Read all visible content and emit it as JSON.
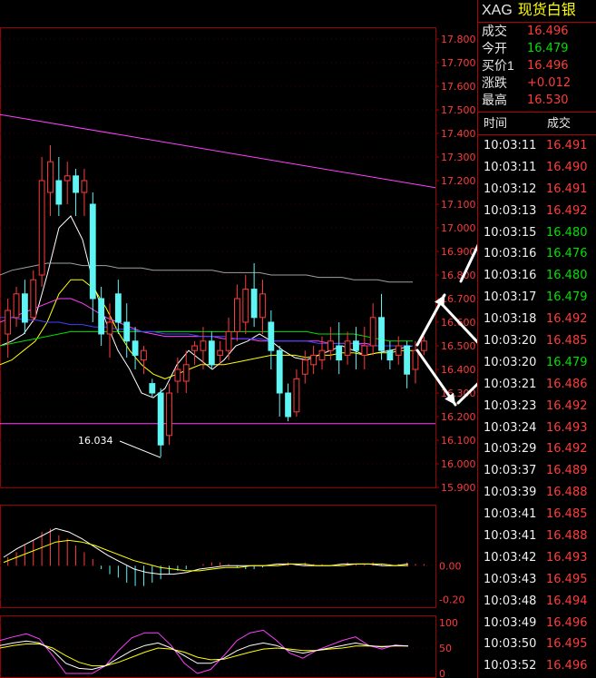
{
  "chart_data": {
    "type": "candlestick",
    "y_ticks": [
      "17.800",
      "17.700",
      "17.600",
      "17.500",
      "17.400",
      "17.300",
      "17.200",
      "17.100",
      "17.000",
      "16.900",
      "16.800",
      "16.700",
      "16.600",
      "16.500",
      "16.400",
      "16.300",
      "16.200",
      "16.100",
      "16.000",
      "15.900"
    ],
    "ylim": [
      15.9,
      17.85
    ],
    "low_marker": {
      "label": "16.034",
      "value": 16.034
    },
    "candles": [
      [
        16.55,
        16.65,
        16.45,
        16.7
      ],
      [
        16.62,
        16.72,
        16.58,
        16.75
      ],
      [
        16.72,
        16.6,
        16.55,
        16.78
      ],
      [
        16.62,
        16.78,
        16.6,
        16.82
      ],
      [
        16.8,
        17.2,
        16.75,
        17.3
      ],
      [
        17.15,
        17.28,
        17.05,
        17.35
      ],
      [
        17.2,
        17.1,
        17.05,
        17.3
      ],
      [
        17.2,
        17.22,
        17.1,
        17.28
      ],
      [
        17.22,
        17.15,
        17.05,
        17.25
      ],
      [
        17.15,
        17.2,
        17.05,
        17.25
      ],
      [
        17.1,
        16.7,
        16.6,
        17.15
      ],
      [
        16.7,
        16.55,
        16.5,
        16.75
      ],
      [
        16.55,
        16.6,
        16.45,
        16.68
      ],
      [
        16.72,
        16.6,
        16.55,
        16.78
      ],
      [
        16.6,
        16.52,
        16.45,
        16.68
      ],
      [
        16.52,
        16.46,
        16.4,
        16.58
      ],
      [
        16.44,
        16.48,
        16.38,
        16.5
      ],
      [
        16.34,
        16.3,
        16.28,
        16.36
      ],
      [
        16.3,
        16.08,
        16.03,
        16.32
      ],
      [
        16.12,
        16.3,
        16.08,
        16.34
      ],
      [
        16.35,
        16.4,
        16.3,
        16.45
      ],
      [
        16.35,
        16.42,
        16.3,
        16.48
      ],
      [
        16.48,
        16.5,
        16.42,
        16.52
      ],
      [
        16.48,
        16.52,
        16.4,
        16.58
      ],
      [
        16.52,
        16.42,
        16.4,
        16.56
      ],
      [
        16.46,
        16.48,
        16.42,
        16.52
      ],
      [
        16.48,
        16.56,
        16.44,
        16.62
      ],
      [
        16.56,
        16.7,
        16.52,
        16.76
      ],
      [
        16.6,
        16.74,
        16.55,
        16.8
      ],
      [
        16.74,
        16.62,
        16.58,
        16.85
      ],
      [
        16.62,
        16.72,
        16.55,
        16.78
      ],
      [
        16.6,
        16.48,
        16.4,
        16.65
      ],
      [
        16.48,
        16.3,
        16.2,
        16.5
      ],
      [
        16.3,
        16.2,
        16.18,
        16.34
      ],
      [
        16.22,
        16.36,
        16.2,
        16.4
      ],
      [
        16.38,
        16.44,
        16.34,
        16.48
      ],
      [
        16.42,
        16.46,
        16.38,
        16.5
      ],
      [
        16.44,
        16.48,
        16.4,
        16.54
      ],
      [
        16.48,
        16.52,
        16.44,
        16.58
      ],
      [
        16.5,
        16.44,
        16.38,
        16.6
      ],
      [
        16.46,
        16.52,
        16.42,
        16.56
      ],
      [
        16.52,
        16.48,
        16.4,
        16.58
      ],
      [
        16.46,
        16.5,
        16.4,
        16.58
      ],
      [
        16.5,
        16.62,
        16.46,
        16.68
      ],
      [
        16.62,
        16.48,
        16.44,
        16.72
      ],
      [
        16.48,
        16.44,
        16.4,
        16.52
      ],
      [
        16.46,
        16.5,
        16.42,
        16.54
      ],
      [
        16.5,
        16.38,
        16.32,
        16.52
      ],
      [
        16.4,
        16.48,
        16.34,
        16.52
      ],
      [
        16.48,
        16.52,
        16.46,
        16.54
      ]
    ],
    "lines": [
      {
        "color": "#ffffff",
        "values": [
          16.5,
          16.52,
          16.55,
          16.62,
          16.8,
          17.0,
          17.05,
          16.95,
          16.75,
          16.6,
          16.48,
          16.4,
          16.3,
          16.28,
          16.32,
          16.42,
          16.48,
          16.44,
          16.4,
          16.44,
          16.5,
          16.52,
          16.55,
          16.52,
          16.48,
          16.45,
          16.44,
          16.46,
          16.48,
          16.5,
          16.48,
          16.46,
          16.47,
          16.48,
          16.49,
          16.5
        ]
      },
      {
        "color": "#ffff00",
        "values": [
          16.42,
          16.44,
          16.48,
          16.52,
          16.6,
          16.72,
          16.78,
          16.78,
          16.74,
          16.66,
          16.56,
          16.48,
          16.42,
          16.38,
          16.36,
          16.38,
          16.4,
          16.42,
          16.42,
          16.42,
          16.43,
          16.44,
          16.45,
          16.46,
          16.46,
          16.46,
          16.45,
          16.46,
          16.46,
          16.47,
          16.47,
          16.46,
          16.47,
          16.47,
          16.48,
          16.48
        ]
      },
      {
        "color": "#ff40ff",
        "values": [
          16.6,
          16.62,
          16.64,
          16.66,
          16.68,
          16.7,
          16.7,
          16.68,
          16.65,
          16.62,
          16.6,
          16.58,
          16.56,
          16.55,
          16.54,
          16.54,
          16.54,
          16.54,
          16.54,
          16.53,
          16.53,
          16.53,
          16.52,
          16.52,
          16.52,
          16.52,
          16.52,
          16.52,
          16.51,
          16.51,
          16.51,
          16.51,
          16.5,
          16.5,
          16.5,
          16.5
        ]
      },
      {
        "color": "#00e000",
        "values": [
          16.5,
          16.51,
          16.52,
          16.53,
          16.54,
          16.55,
          16.56,
          16.56,
          16.56,
          16.56,
          16.56,
          16.56,
          16.56,
          16.56,
          16.56,
          16.56,
          16.56,
          16.56,
          16.56,
          16.56,
          16.56,
          16.56,
          16.56,
          16.56,
          16.56,
          16.56,
          16.56,
          16.55,
          16.55,
          16.55,
          16.55,
          16.54,
          16.53,
          16.52,
          16.52,
          16.52
        ]
      },
      {
        "color": "#4040ff",
        "values": [
          16.62,
          16.62,
          16.61,
          16.61,
          16.6,
          16.6,
          16.59,
          16.59,
          16.58,
          16.58,
          16.57,
          16.57,
          16.56,
          16.56,
          16.55,
          16.55,
          16.55,
          16.54,
          16.54,
          16.54,
          16.53,
          16.53,
          16.53,
          16.52,
          16.52,
          16.52,
          16.52,
          16.51,
          16.51,
          16.51,
          16.51,
          16.5,
          16.5,
          16.5,
          16.5,
          16.5
        ]
      },
      {
        "color": "#a0a0a0",
        "values": [
          16.8,
          16.82,
          16.83,
          16.84,
          16.85,
          16.85,
          16.85,
          16.84,
          16.84,
          16.84,
          16.83,
          16.83,
          16.83,
          16.82,
          16.82,
          16.82,
          16.82,
          16.82,
          16.82,
          16.81,
          16.81,
          16.81,
          16.81,
          16.8,
          16.8,
          16.8,
          16.8,
          16.79,
          16.79,
          16.79,
          16.78,
          16.78,
          16.78,
          16.77,
          16.77,
          16.77
        ]
      }
    ],
    "trendline": {
      "color": "#ff40ff",
      "from": [
        -0.5,
        17.48
      ],
      "to": [
        1,
        17.17
      ]
    },
    "support": {
      "color": "#ff40ff",
      "value": 16.17
    },
    "macd": {
      "y_ticks": [
        "0.00",
        "-0.20"
      ],
      "ylim": [
        -0.24,
        0.34
      ],
      "bars": [
        0.05,
        0.08,
        0.12,
        0.15,
        0.2,
        0.22,
        0.18,
        0.16,
        0.12,
        0.08,
        0.04,
        -0.02,
        -0.05,
        -0.07,
        -0.1,
        -0.12,
        -0.12,
        -0.1,
        -0.08,
        -0.05,
        -0.03,
        -0.02,
        0.0,
        0.01,
        0.02,
        0.02,
        0.01,
        -0.01,
        -0.02,
        -0.02,
        -0.01,
        0.0,
        0.01,
        0.02,
        0.01,
        0.02,
        0.01,
        0.01,
        0.0,
        0.01,
        0.02,
        0.01,
        0.01,
        0.02,
        0.01,
        0.01,
        0.01,
        0.02,
        0.01,
        0.01
      ],
      "dif": [
        0.05,
        0.1,
        0.14,
        0.18,
        0.22,
        0.2,
        0.16,
        0.11,
        0.06,
        0.02,
        -0.02,
        -0.04,
        -0.05,
        -0.05,
        -0.04,
        -0.02,
        -0.01,
        0.0,
        0.0,
        0.0,
        0.0,
        0.01,
        0.01,
        0.0,
        0.0,
        0.0,
        0.01,
        0.01,
        0.01,
        0.0,
        0.0,
        0.01
      ],
      "dea": [
        0.02,
        0.05,
        0.08,
        0.11,
        0.14,
        0.15,
        0.14,
        0.12,
        0.09,
        0.06,
        0.03,
        0.01,
        -0.01,
        -0.02,
        -0.03,
        -0.03,
        -0.02,
        -0.01,
        -0.01,
        0.0,
        0.0,
        0.0,
        0.01,
        0.01,
        0.0,
        0.0,
        0.0,
        0.01,
        0.01,
        0.01,
        0.0,
        0.0
      ]
    },
    "kdj": {
      "y_ticks": [
        "100",
        "50",
        "0"
      ],
      "ylim": [
        0,
        100
      ],
      "k": [
        55,
        60,
        64,
        60,
        45,
        20,
        10,
        8,
        15,
        30,
        45,
        55,
        60,
        50,
        35,
        20,
        20,
        30,
        45,
        55,
        60,
        55,
        45,
        40,
        45,
        50,
        55,
        60,
        55,
        52,
        55,
        54
      ],
      "d": [
        50,
        55,
        58,
        58,
        50,
        35,
        22,
        15,
        15,
        22,
        32,
        42,
        50,
        48,
        42,
        32,
        27,
        28,
        35,
        42,
        48,
        50,
        48,
        45,
        45,
        48,
        50,
        54,
        54,
        53,
        54,
        54
      ],
      "j": [
        65,
        72,
        78,
        68,
        35,
        0,
        0,
        0,
        15,
        45,
        70,
        80,
        80,
        55,
        20,
        0,
        8,
        35,
        65,
        80,
        85,
        65,
        40,
        30,
        45,
        55,
        65,
        72,
        55,
        48,
        56,
        54
      ]
    }
  },
  "quote": {
    "code": "XAG",
    "name": "现货白银",
    "rows": [
      {
        "label": "成交",
        "value": "16.496",
        "color": "red"
      },
      {
        "label": "今开",
        "value": "16.479",
        "color": "green"
      },
      {
        "label": "买价1",
        "value": "16.496",
        "color": "red"
      },
      {
        "label": "涨跌",
        "value": "+0.012",
        "color": "red"
      },
      {
        "label": "最高",
        "value": "16.530",
        "color": "red"
      }
    ],
    "col_time": "时间",
    "col_price": "成交",
    "ticks": [
      {
        "t": "10:03:11",
        "p": "16.491",
        "c": "red"
      },
      {
        "t": "10:03:11",
        "p": "16.490",
        "c": "red"
      },
      {
        "t": "10:03:12",
        "p": "16.491",
        "c": "red"
      },
      {
        "t": "10:03:13",
        "p": "16.492",
        "c": "red"
      },
      {
        "t": "10:03:15",
        "p": "16.480",
        "c": "green"
      },
      {
        "t": "10:03:16",
        "p": "16.476",
        "c": "green"
      },
      {
        "t": "10:03:16",
        "p": "16.480",
        "c": "green"
      },
      {
        "t": "10:03:17",
        "p": "16.479",
        "c": "green"
      },
      {
        "t": "10:03:18",
        "p": "16.492",
        "c": "red"
      },
      {
        "t": "10:03:20",
        "p": "16.485",
        "c": "red"
      },
      {
        "t": "10:03:20",
        "p": "16.479",
        "c": "green"
      },
      {
        "t": "10:03:21",
        "p": "16.486",
        "c": "red"
      },
      {
        "t": "10:03:23",
        "p": "16.492",
        "c": "red"
      },
      {
        "t": "10:03:24",
        "p": "16.493",
        "c": "red"
      },
      {
        "t": "10:03:29",
        "p": "16.492",
        "c": "red"
      },
      {
        "t": "10:03:37",
        "p": "16.489",
        "c": "red"
      },
      {
        "t": "10:03:39",
        "p": "16.488",
        "c": "red"
      },
      {
        "t": "10:03:41",
        "p": "16.485",
        "c": "red"
      },
      {
        "t": "10:03:41",
        "p": "16.488",
        "c": "red"
      },
      {
        "t": "10:03:42",
        "p": "16.493",
        "c": "red"
      },
      {
        "t": "10:03:43",
        "p": "16.495",
        "c": "red"
      },
      {
        "t": "10:03:48",
        "p": "16.494",
        "c": "red"
      },
      {
        "t": "10:03:49",
        "p": "16.496",
        "c": "red"
      },
      {
        "t": "10:03:50",
        "p": "16.495",
        "c": "red"
      },
      {
        "t": "10:03:52",
        "p": "16.496",
        "c": "red"
      }
    ]
  }
}
